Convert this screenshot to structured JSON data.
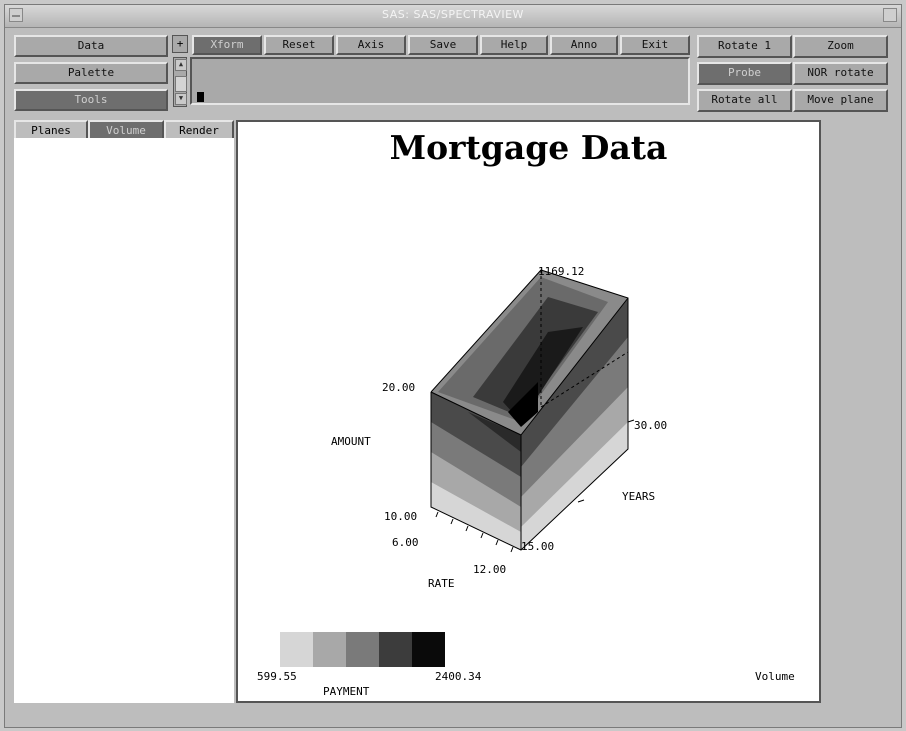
{
  "window": {
    "title": "SAS: SAS/SPECTRAVIEW"
  },
  "left_buttons": {
    "data": "Data",
    "palette": "Palette",
    "tools": "Tools"
  },
  "toolbar": {
    "plus": "+",
    "xform": "Xform",
    "reset": "Reset",
    "axis": "Axis",
    "save": "Save",
    "help": "Help",
    "anno": "Anno",
    "exit": "Exit"
  },
  "right_buttons": {
    "rotate1": "Rotate 1",
    "zoom": "Zoom",
    "probe": "Probe",
    "nor_rotate": "NOR rotate",
    "rotate_all": "Rotate all",
    "move_plane": "Move plane"
  },
  "tabs": {
    "planes": "Planes",
    "volume": "Volume",
    "render": "Render"
  },
  "plot": {
    "title": "Mortgage Data",
    "amount_label": "AMOUNT",
    "years_label": "YEARS",
    "rate_label": "RATE",
    "tick_top": "1169.12",
    "tick_20": "20.00",
    "tick_30": "30.00",
    "tick_10": "10.00",
    "tick_6": "6.00",
    "tick_15": "15.00",
    "tick_12": "12.00",
    "legend_min": "599.55",
    "legend_max": "2400.34",
    "legend_label": "PAYMENT",
    "mode_label": "Volume"
  },
  "colors": {
    "legend": [
      "#d6d6d6",
      "#a8a8a8",
      "#7a7a7a",
      "#3c3c3c",
      "#0a0a0a"
    ]
  }
}
